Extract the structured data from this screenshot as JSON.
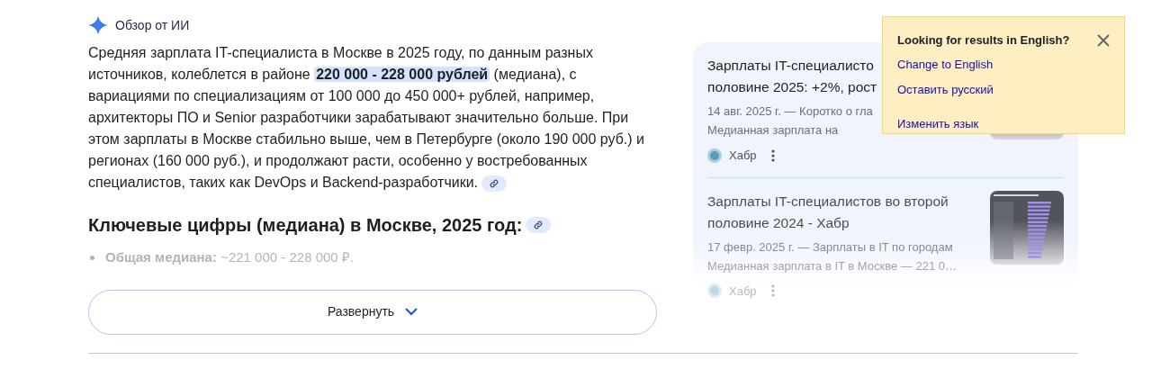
{
  "overview": {
    "title": "Обзор от ИИ"
  },
  "summary": {
    "before": "Средняя зарплата IT-специалиста в Москве в 2025 году, по данным разных источников, колеблется в районе ",
    "highlight": "220 000 - 228 000 рублей",
    "after": " (медиана), с вариациями по специализациям от 100 000 до 450 000+ рублей, например, архитекторы ПО и Senior разработчики зарабатывают значительно больше. При этом зарплаты в Москве стабильно выше, чем в Петербурге (около 190 000 руб.) и регионах (160 000 руб.), и продолжают расти, особенно у востребованных специалистов, таких как DevOps и Backend-разработчики."
  },
  "section": {
    "heading": "Ключевые цифры (медиана) в Москве, 2025 год:",
    "bullets": [
      "**Общая медиана:** ~221 000 - 228 000 ₽."
    ]
  },
  "expand_button": {
    "label": "Развернуть"
  },
  "sources": [
    {
      "title_lines": [
        "Зарплаты IT-специалисто",
        "половине 2025: +2%, рост"
      ],
      "snippet_lines": [
        "14 авг. 2025 г. — Коротко о гла",
        "Медианная зарплата на"
      ],
      "site": "Хабр",
      "faded": false
    },
    {
      "title_lines": [
        "Зарплаты IT-специалистов во второй",
        "половине 2024 - Хабр"
      ],
      "snippet_lines": [
        "17 февр. 2025 г. — Зарплаты в IT по городам",
        "Медианная зарплата в IT в Москве — 221 0…"
      ],
      "site": "Хабр",
      "faded": true
    }
  ],
  "language_popup": {
    "question": "Looking for results in English?",
    "links": [
      "Change to English",
      "Оставить русский",
      "Изменить язык"
    ]
  }
}
